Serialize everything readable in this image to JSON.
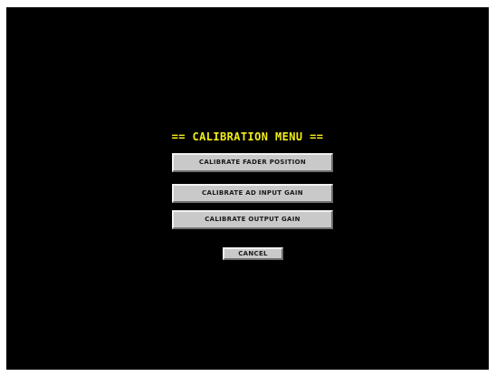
{
  "menu": {
    "title": "== CALIBRATION MENU ==",
    "buttons": [
      {
        "label": "CALIBRATE FADER POSITION"
      },
      {
        "label": "CALIBRATE AD INPUT GAIN"
      },
      {
        "label": "CALIBRATE OUTPUT GAIN"
      }
    ],
    "cancel_label": "CANCEL"
  },
  "colors": {
    "screen_background": "#000000",
    "title_text": "#f2ee16",
    "button_face": "#c9c9c9",
    "button_text": "#1a1a1a"
  }
}
